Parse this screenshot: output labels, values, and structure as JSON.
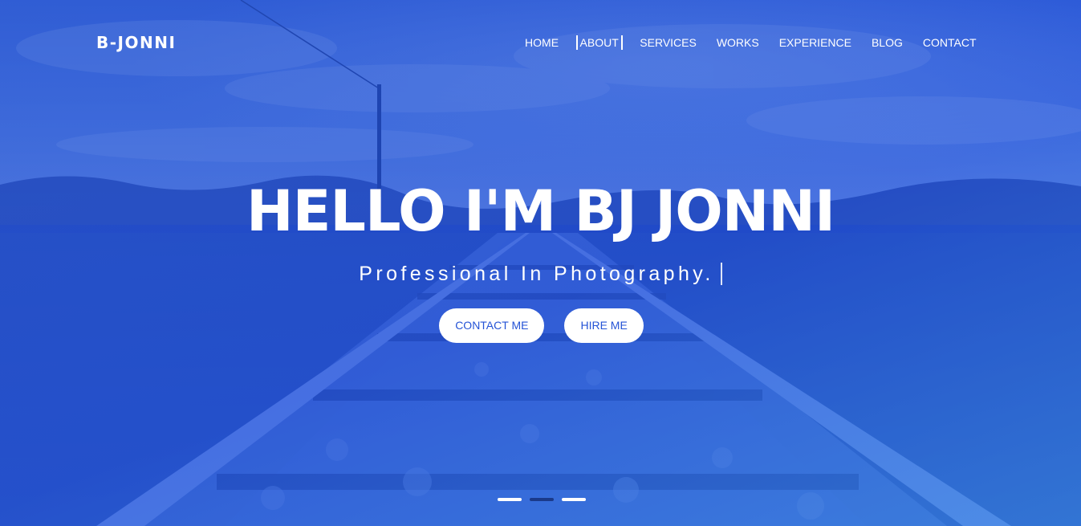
{
  "brand": {
    "name": "B-JONNI"
  },
  "nav": {
    "items": [
      {
        "label": "HOME"
      },
      {
        "label": "ABOUT",
        "active": true
      },
      {
        "label": "SERVICES"
      },
      {
        "label": "WORKS"
      },
      {
        "label": "EXPERIENCE"
      },
      {
        "label": "BLOG"
      },
      {
        "label": "CONTACT"
      }
    ]
  },
  "hero": {
    "headline": "HELLO I'M BJ JONNI",
    "subline": "Professional In Photography.",
    "buttons": {
      "contact_label": "CONTACT ME",
      "hire_label": "HIRE ME"
    },
    "slider": {
      "count": 3,
      "active_index": 1
    }
  },
  "colors": {
    "overlay_blue": "#1d4fd8",
    "button_text": "#2453d6",
    "active_indicator": "#1a3a8a"
  }
}
